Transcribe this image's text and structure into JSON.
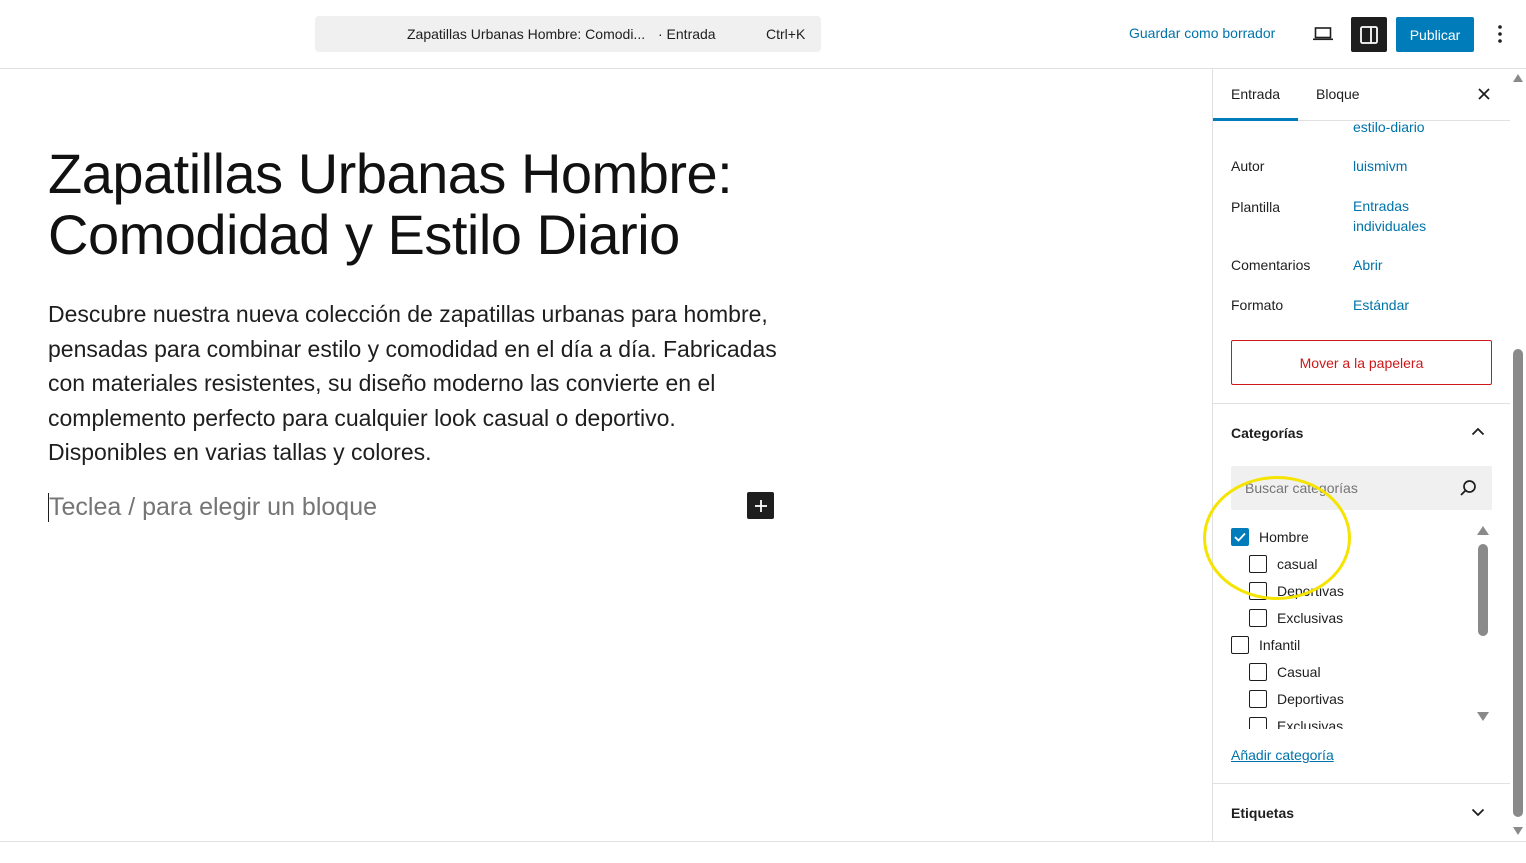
{
  "header": {
    "doc_title": "Zapatillas Urbanas Hombre: Comodi...",
    "doc_type": "· Entrada",
    "shortcut": "Ctrl+K",
    "save_draft_label": "Guardar como borrador",
    "publish_label": "Publicar"
  },
  "editor": {
    "title": "Zapatillas Urbanas Hombre: Comodidad y Estilo Diario",
    "paragraph": "Descubre nuestra nueva colección de zapatillas urbanas para hombre, pensadas para combinar estilo y comodidad en el día a día. Fabricadas con materiales resistentes, su diseño moderno las convierte en el complemento perfecto para cualquier look casual o deportivo. Disponibles en varias tallas y colores.",
    "placeholder": "Teclea / para elegir un bloque"
  },
  "sidebar": {
    "tabs": [
      {
        "label": "Entrada",
        "active": true
      },
      {
        "label": "Bloque",
        "active": false
      }
    ],
    "slug_partial": "estilo-diario",
    "meta": [
      {
        "label": "Autor",
        "value": "luismivm"
      },
      {
        "label": "Plantilla",
        "value": "Entradas individuales"
      },
      {
        "label": "Comentarios",
        "value": "Abrir"
      },
      {
        "label": "Formato",
        "value": "Estándar"
      }
    ],
    "trash_label": "Mover a la papelera",
    "categories": {
      "title": "Categorías",
      "search_placeholder": "Buscar categorías",
      "items": [
        {
          "label": "Hombre",
          "checked": true,
          "level": 0
        },
        {
          "label": "casual",
          "checked": false,
          "level": 1
        },
        {
          "label": "Deportivas",
          "checked": false,
          "level": 1
        },
        {
          "label": "Exclusivas",
          "checked": false,
          "level": 1
        },
        {
          "label": "Infantil",
          "checked": false,
          "level": 0
        },
        {
          "label": "Casual",
          "checked": false,
          "level": 1
        },
        {
          "label": "Deportivas",
          "checked": false,
          "level": 1
        },
        {
          "label": "Exclusivas",
          "checked": false,
          "level": 1
        }
      ],
      "add_label": "Añadir categoría"
    },
    "tags_title": "Etiquetas"
  },
  "colors": {
    "accent": "#007cba",
    "link": "#0073aa",
    "danger": "#cc1818",
    "highlight": "#f5e400"
  }
}
